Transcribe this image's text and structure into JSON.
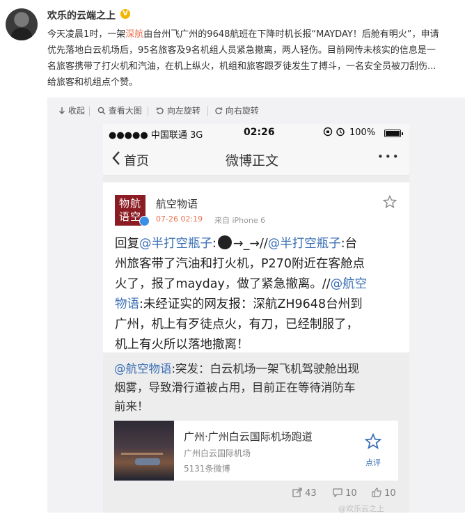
{
  "author": {
    "name": "欢乐的云端之上",
    "verified_badge": "V"
  },
  "post": {
    "line1_a": "今天凌晨1时，一架",
    "line1_hl": "深航",
    "line1_b": "由台州飞广州的9648航班在下降时机长报“MAYDAY！后舱有明火”，申请",
    "line2": "优先落地白云机场后，95名旅客及9名机组人员紧急撤离，两人轻伤。目前网传未核实的信息是一",
    "line3": "名旅客携带了打火机和汽油，在机上纵火，机组和旅客跟歹徒发生了搏斗，一名安全员被刀刮伤...",
    "line4": "给旅客和机组点个赞。"
  },
  "toolbar": {
    "collapse": "收起",
    "view_large": "查看大图",
    "rotate_left": "向左旋转",
    "rotate_right": "向右旋转"
  },
  "phone": {
    "status": {
      "carrier": "●●●●● 中国联通  3G",
      "time": "02:26",
      "battery": "100%"
    },
    "nav": {
      "back": "首页",
      "title": "微博正文",
      "more": "•••"
    },
    "card": {
      "logo_text_1": "物航",
      "logo_text_2": "语空",
      "account": "航空物语",
      "meta_date": "07-26 02:19",
      "meta_source": "来自 iPhone 6",
      "body_1a": "回复",
      "body_1b": "@半打空瓶子",
      "body_1c": ":",
      "body_1d": "→_→//",
      "body_1e": "@半打空瓶子",
      "body_1f": ":台",
      "body_2": "州旅客带了汽油和打火机，P270附近在客舱点",
      "body_3a": "火了，报了mayday，做了紧急撤离。//",
      "body_3b": "@航空",
      "body_4a": "物语",
      "body_4b": ":未经证实的网友报：深航ZH9648台州到",
      "body_5": "广州，机上有歹徒点火，有刀，已经制服了，",
      "body_6": "机上有火所以落地撤离！"
    },
    "retweet": {
      "mention": "@航空物语",
      "text_1": ":突发：白云机场一架飞机驾驶舱出现",
      "text_2": "烟雾，导致滑行道被占用，目前正在等待消防车",
      "text_3": "前来！"
    },
    "place": {
      "title": "广州·广州白云国际机场跑道",
      "subtitle": "广州白云国际机场",
      "count": "5131条微博",
      "review": "点评"
    }
  },
  "actions": {
    "forward": "43",
    "comment": "10",
    "like": "10"
  },
  "watermark": "@欢乐云之上",
  "colors": {
    "accent": "#eb7350",
    "link": "#3a6fb5",
    "logo_red": "#8b1c24"
  }
}
